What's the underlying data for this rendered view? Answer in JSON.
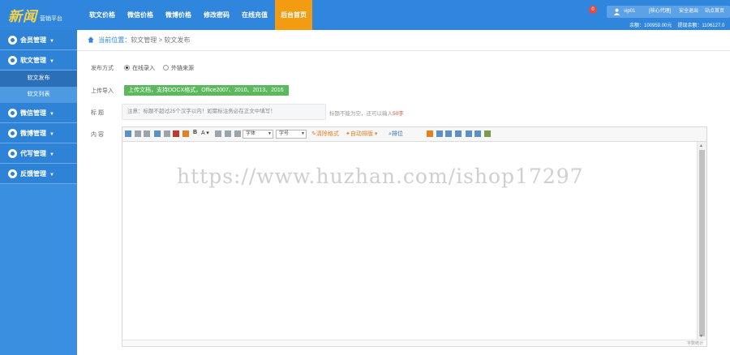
{
  "brand": {
    "logo_text": "新闻",
    "subtitle": "营销平台"
  },
  "nav": [
    {
      "label": "软文价格",
      "active": false
    },
    {
      "label": "微信价格",
      "active": false
    },
    {
      "label": "微博价格",
      "active": false
    },
    {
      "label": "修改密码",
      "active": false
    },
    {
      "label": "在线充值",
      "active": false
    },
    {
      "label": "后台首页",
      "active": true
    }
  ],
  "header": {
    "notification_count": "0",
    "user_name": "vip01",
    "user_level": "[核心代理]",
    "logout": "安全退出",
    "site_home": "站点首页",
    "balance_text": "余额：100959.00元",
    "withdraw_text": "提现余额：1106127.0"
  },
  "sidebar": {
    "groups": [
      {
        "label": "会员管理"
      },
      {
        "label": "软文管理",
        "children": [
          {
            "label": "软文发布",
            "active": true
          },
          {
            "label": "软文列表",
            "active": false
          }
        ]
      },
      {
        "label": "微信管理"
      },
      {
        "label": "微博管理"
      },
      {
        "label": "代写管理"
      },
      {
        "label": "反馈管理"
      }
    ]
  },
  "breadcrumb": {
    "label": "当前位置：",
    "path": "软文管理 > 软文发布"
  },
  "form": {
    "publish_mode_label": "发布方式",
    "mode_online": "在线录入",
    "mode_external": "外链来源",
    "upload_label": "上传导入",
    "upload_button": "上传文档，支持DOCX格式，Office2007、2010、2013、2016",
    "title_label": "标  题",
    "title_placeholder": "注意：标题不超过25个汉字以内！如需标注务必在正文中填写！",
    "title_hint": "标题不能为空，还可以输入",
    "title_hint_count": "50字",
    "content_label": "内  容"
  },
  "editor": {
    "font_family": "字体",
    "font_size": "字号",
    "clear_format": "清除格式",
    "auto_layout": "自动排版",
    "sort": "排位",
    "word_count": "字数统计"
  },
  "watermark": "https://www.huzhan.com/ishop17297",
  "colors": {
    "topbar": "#2f86dc",
    "active_nav": "#f39c12",
    "upload_button": "#5cb85c"
  }
}
